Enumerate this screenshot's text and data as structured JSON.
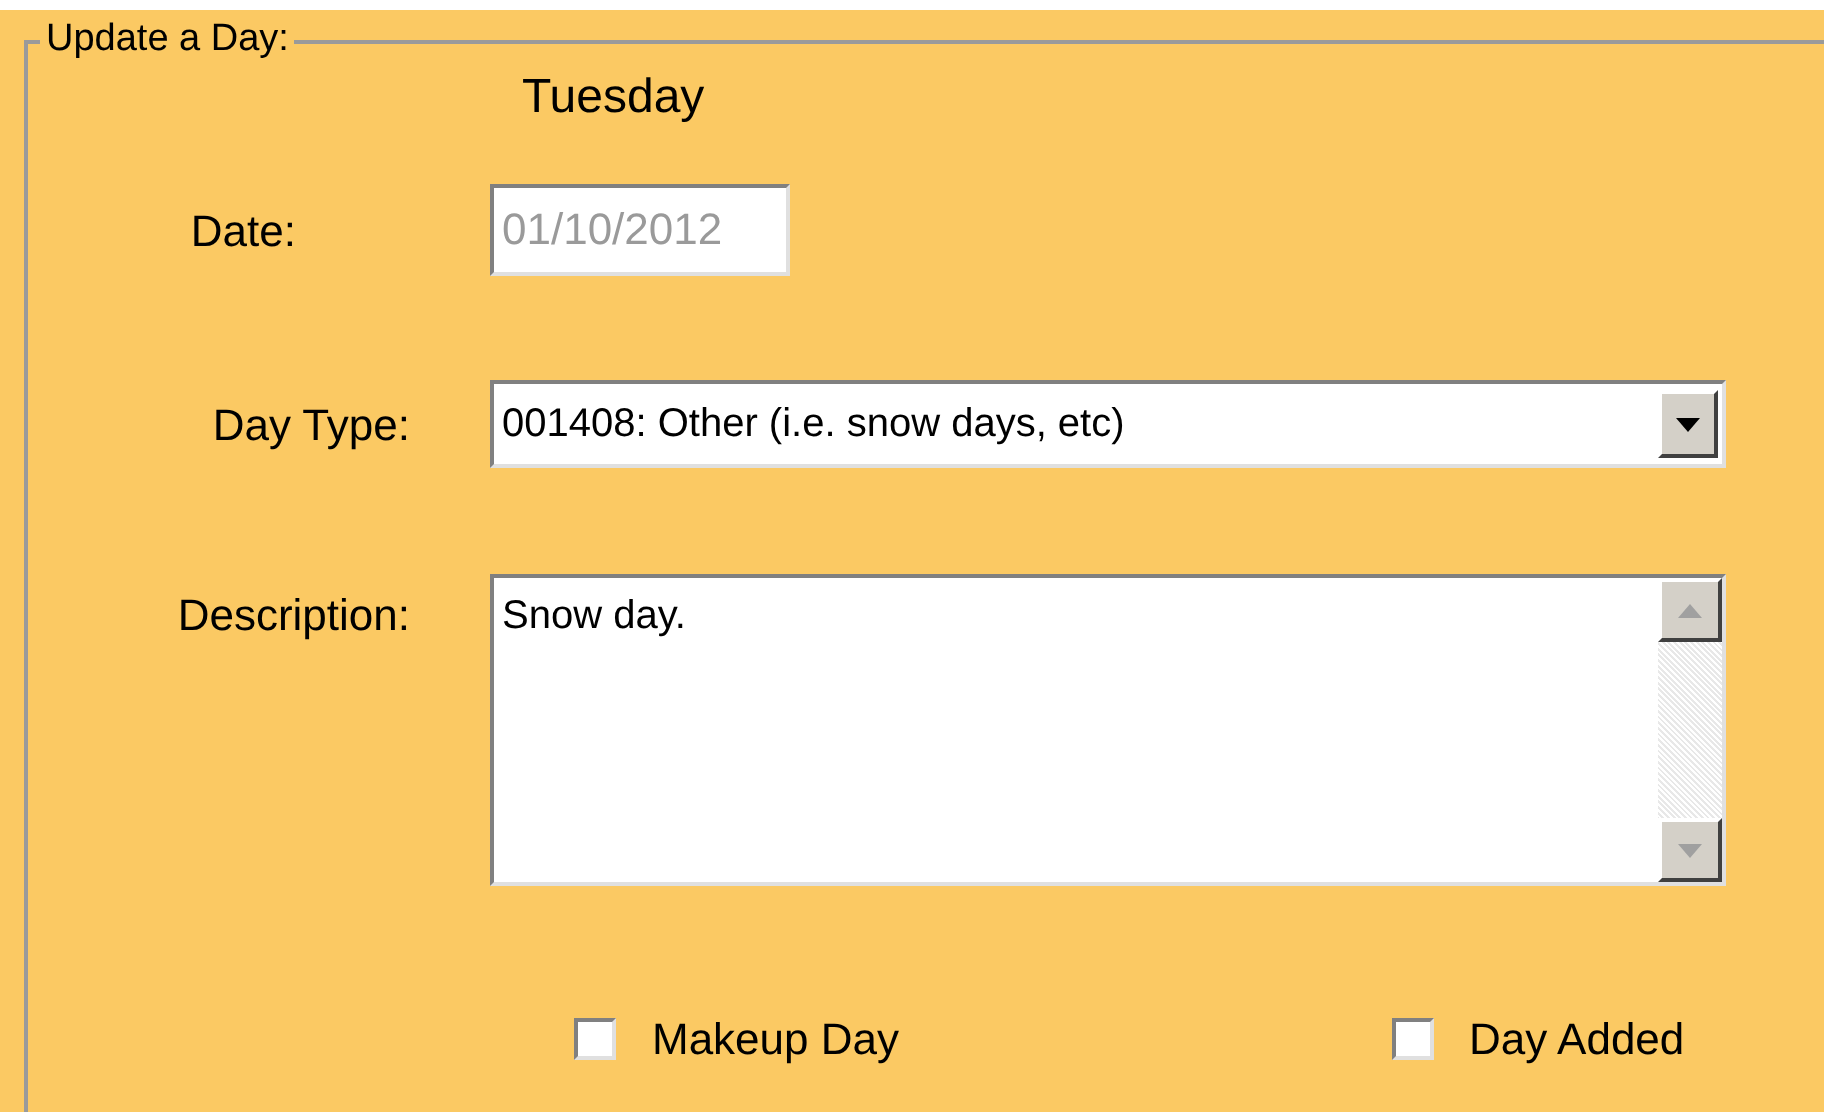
{
  "group": {
    "title": "Update a Day:"
  },
  "day_name": "Tuesday",
  "fields": [
    {
      "kind": "text",
      "label": "Date:",
      "value": "01/10/2012",
      "disabled": true
    },
    {
      "kind": "combo",
      "label": "Day Type:",
      "value": "001408: Other (i.e. snow days, etc)"
    },
    {
      "kind": "memo",
      "label": "Description:",
      "value": "Snow day."
    }
  ],
  "checkboxes": [
    {
      "label": "Makeup Day",
      "checked": false
    },
    {
      "label": "Day Added",
      "checked": false
    }
  ]
}
